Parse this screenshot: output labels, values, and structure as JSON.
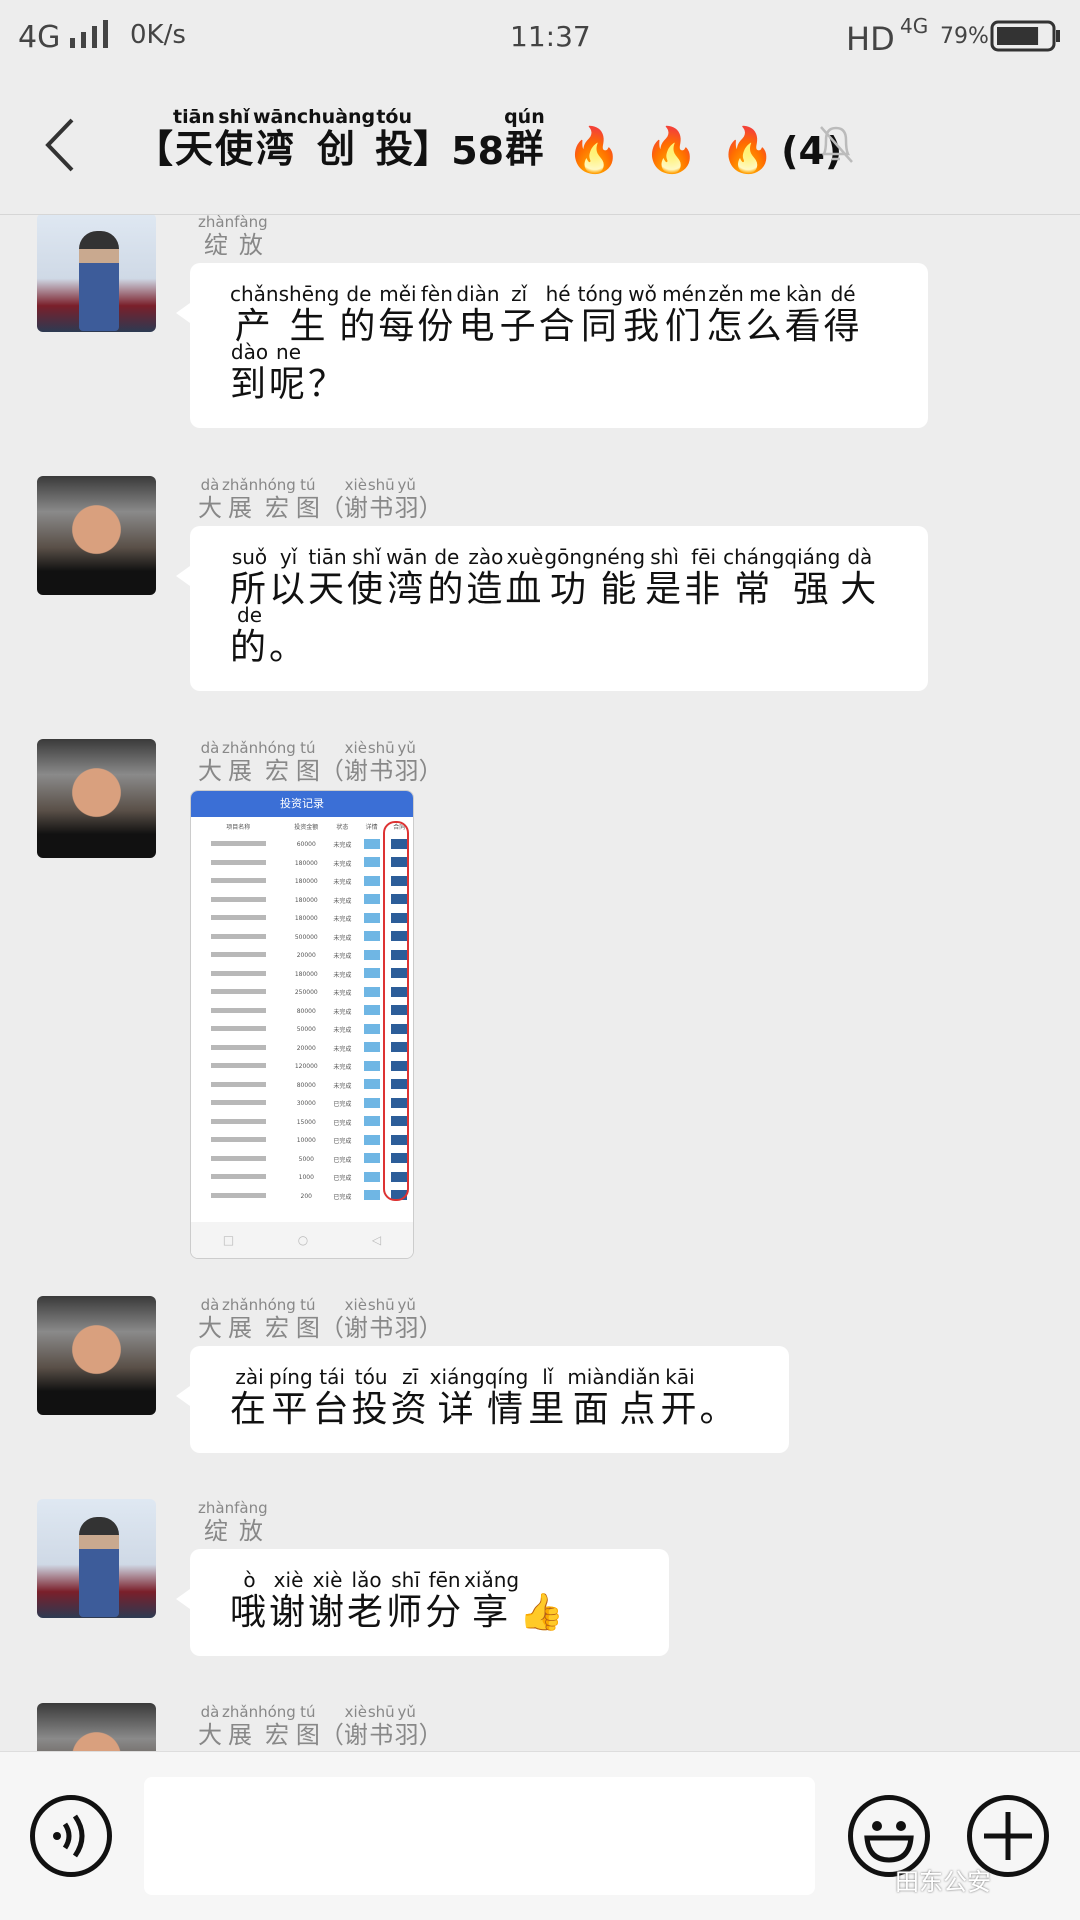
{
  "status_bar": {
    "network": "4G",
    "speed": "0K/s",
    "time": "11:37",
    "hd": "HD",
    "net2": "4G",
    "battery": "79%",
    "battery_level": 0.79
  },
  "header": {
    "title_parts": [
      [
        "【",
        ""
      ],
      [
        "天",
        "tiān"
      ],
      [
        "使",
        "shǐ"
      ],
      [
        "湾",
        "wān"
      ],
      [
        "创",
        "chuàng"
      ],
      [
        "投",
        "tóu"
      ],
      [
        "】",
        ""
      ],
      [
        "58",
        ""
      ],
      [
        "群",
        "qún"
      ]
    ],
    "member_count": "(4)",
    "fire_emoji": "🔥"
  },
  "messages": [
    {
      "sender": [
        [
          "绽",
          "zhàn"
        ],
        [
          "放",
          "fàng"
        ]
      ],
      "avatar": "a",
      "type": "text",
      "text": [
        [
          "产",
          "chǎn"
        ],
        [
          "生",
          "shēng"
        ],
        [
          "的",
          "de"
        ],
        [
          "每",
          "měi"
        ],
        [
          "份",
          "fèn"
        ],
        [
          "电",
          "diàn"
        ],
        [
          "子",
          "zǐ"
        ],
        [
          "合",
          "hé"
        ],
        [
          "同",
          "tóng"
        ],
        [
          "我",
          "wǒ"
        ],
        [
          "们",
          "mén"
        ],
        [
          "怎",
          "zěn"
        ],
        [
          "么",
          "me"
        ],
        [
          "看",
          "kàn"
        ],
        [
          "得",
          "dé"
        ],
        [
          "到",
          "dào"
        ],
        [
          "呢",
          "ne"
        ],
        [
          "？",
          ""
        ]
      ]
    },
    {
      "sender": [
        [
          "大",
          "dà"
        ],
        [
          "展",
          "zhǎn"
        ],
        [
          "宏",
          "hóng"
        ],
        [
          "图",
          "tú"
        ],
        [
          "（",
          ""
        ],
        [
          "谢",
          "xiè"
        ],
        [
          "书",
          "shū"
        ],
        [
          "羽",
          "yǔ"
        ],
        [
          "）",
          ""
        ]
      ],
      "avatar": "b",
      "type": "text",
      "text": [
        [
          "所",
          "suǒ"
        ],
        [
          "以",
          "yǐ"
        ],
        [
          "天",
          "tiān"
        ],
        [
          "使",
          "shǐ"
        ],
        [
          "湾",
          "wān"
        ],
        [
          "的",
          "de"
        ],
        [
          "造",
          "zào"
        ],
        [
          "血",
          "xuè"
        ],
        [
          "功",
          "gōng"
        ],
        [
          "能",
          "néng"
        ],
        [
          "是",
          "shì"
        ],
        [
          "非",
          "fēi"
        ],
        [
          "常",
          "cháng"
        ],
        [
          "强",
          "qiáng"
        ],
        [
          "大",
          "dà"
        ],
        [
          "的",
          "de"
        ],
        [
          "。",
          ""
        ]
      ]
    },
    {
      "sender": [
        [
          "大",
          "dà"
        ],
        [
          "展",
          "zhǎn"
        ],
        [
          "宏",
          "hóng"
        ],
        [
          "图",
          "tú"
        ],
        [
          "（",
          ""
        ],
        [
          "谢",
          "xiè"
        ],
        [
          "书",
          "shū"
        ],
        [
          "羽",
          "yǔ"
        ],
        [
          "）",
          ""
        ]
      ],
      "avatar": "b",
      "type": "image"
    },
    {
      "sender": [
        [
          "大",
          "dà"
        ],
        [
          "展",
          "zhǎn"
        ],
        [
          "宏",
          "hóng"
        ],
        [
          "图",
          "tú"
        ],
        [
          "（",
          ""
        ],
        [
          "谢",
          "xiè"
        ],
        [
          "书",
          "shū"
        ],
        [
          "羽",
          "yǔ"
        ],
        [
          "）",
          ""
        ]
      ],
      "avatar": "b",
      "type": "text",
      "text": [
        [
          "在",
          "zài"
        ],
        [
          "平",
          "píng"
        ],
        [
          "台",
          "tái"
        ],
        [
          "投",
          "tóu"
        ],
        [
          "资",
          "zī"
        ],
        [
          "详",
          "xiáng"
        ],
        [
          "情",
          "qíng"
        ],
        [
          "里",
          "lǐ"
        ],
        [
          "面",
          "miàn"
        ],
        [
          "点",
          "diǎn"
        ],
        [
          "开",
          "kāi"
        ],
        [
          "。",
          ""
        ]
      ]
    },
    {
      "sender": [
        [
          "绽",
          "zhàn"
        ],
        [
          "放",
          "fàng"
        ]
      ],
      "avatar": "a",
      "type": "text",
      "text": [
        [
          "哦",
          "ò"
        ],
        [
          "谢",
          "xiè"
        ],
        [
          "谢",
          "xiè"
        ],
        [
          "老",
          "lǎo"
        ],
        [
          "师",
          "shī"
        ],
        [
          "分",
          "fēn"
        ],
        [
          "享",
          "xiǎng"
        ],
        [
          "👍",
          ""
        ]
      ]
    },
    {
      "sender": [
        [
          "大",
          "dà"
        ],
        [
          "展",
          "zhǎn"
        ],
        [
          "宏",
          "hóng"
        ],
        [
          "图",
          "tú"
        ],
        [
          "（",
          ""
        ],
        [
          "谢",
          "xiè"
        ],
        [
          "书",
          "shū"
        ],
        [
          "羽",
          "yǔ"
        ],
        [
          "）",
          ""
        ]
      ],
      "avatar": "b",
      "type": "partial"
    }
  ],
  "shared_image": {
    "title": "投资记录",
    "columns": [
      "项目名称",
      "投资金额",
      "状态",
      "详情",
      "合同"
    ],
    "amounts": [
      "60000",
      "180000",
      "180000",
      "180000",
      "180000",
      "500000",
      "20000",
      "180000",
      "250000",
      "80000",
      "50000",
      "20000",
      "120000",
      "80000",
      "30000",
      "15000",
      "10000",
      "5000",
      "1000",
      "200"
    ],
    "statuses": [
      "未完成",
      "未完成",
      "未完成",
      "未完成",
      "未完成",
      "未完成",
      "未完成",
      "未完成",
      "未完成",
      "未完成",
      "未完成",
      "未完成",
      "未完成",
      "未完成",
      "已完成",
      "已完成",
      "已完成",
      "已完成",
      "已完成",
      "已完成"
    ]
  },
  "watermark": "田东公安"
}
